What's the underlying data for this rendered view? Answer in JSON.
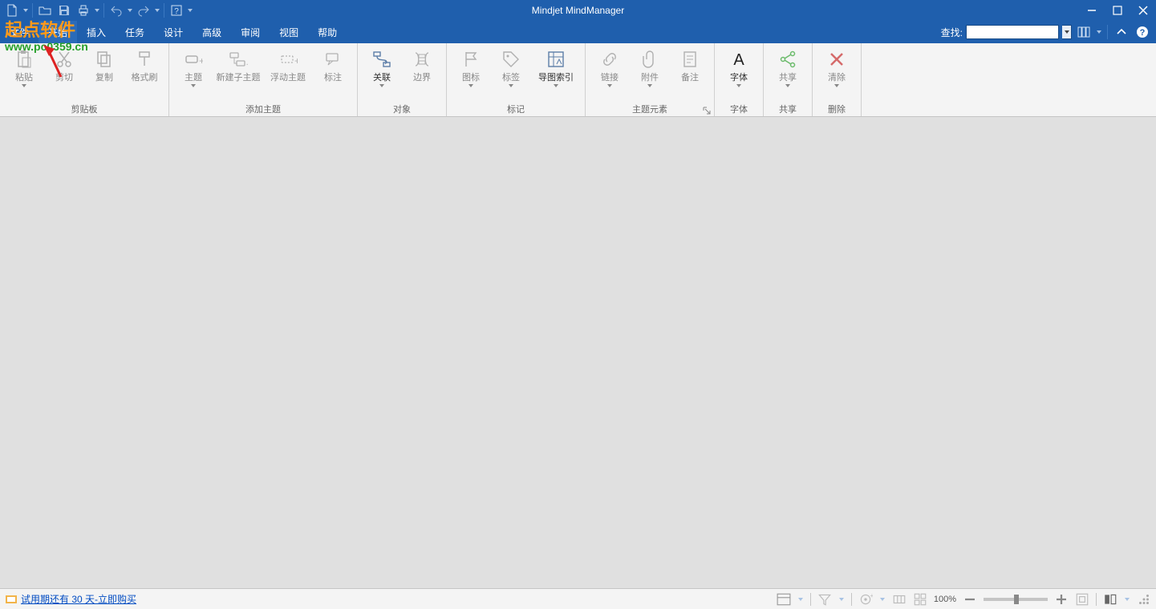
{
  "app_title": "Mindjet MindManager",
  "menubar": {
    "items": [
      "文件",
      "开始",
      "插入",
      "任务",
      "设计",
      "高级",
      "审阅",
      "视图",
      "帮助"
    ],
    "search_label": "查找:"
  },
  "ribbon": {
    "groups": [
      {
        "name": "clipboard",
        "label": "剪贴板",
        "buttons": [
          {
            "id": "paste",
            "label": "粘贴",
            "dd": true
          },
          {
            "id": "cut",
            "label": "剪切"
          },
          {
            "id": "copy",
            "label": "复制"
          },
          {
            "id": "formatpainter",
            "label": "格式刷"
          }
        ]
      },
      {
        "name": "addtopic",
        "label": "添加主题",
        "buttons": [
          {
            "id": "topic",
            "label": "主题",
            "dd": true
          },
          {
            "id": "subtopic",
            "label": "新建子主题",
            "wide": true
          },
          {
            "id": "floattopic",
            "label": "浮动主题",
            "wide": true
          },
          {
            "id": "callout",
            "label": "标注"
          }
        ]
      },
      {
        "name": "object",
        "label": "对象",
        "buttons": [
          {
            "id": "relation",
            "label": "关联",
            "dd": true,
            "strong": true
          },
          {
            "id": "boundary",
            "label": "边界"
          }
        ]
      },
      {
        "name": "mark",
        "label": "标记",
        "buttons": [
          {
            "id": "icon",
            "label": "图标",
            "dd": true
          },
          {
            "id": "tag",
            "label": "标签",
            "dd": true
          },
          {
            "id": "mapindex",
            "label": "导图索引",
            "dd": true,
            "strong": true,
            "wide": true
          }
        ]
      },
      {
        "name": "topicel",
        "label": "主题元素",
        "launcher": true,
        "buttons": [
          {
            "id": "link",
            "label": "链接",
            "dd": true
          },
          {
            "id": "attach",
            "label": "附件",
            "dd": true
          },
          {
            "id": "note",
            "label": "备注"
          }
        ]
      },
      {
        "name": "font",
        "label": "字体",
        "buttons": [
          {
            "id": "font",
            "label": "字体",
            "dd": true,
            "strong": true
          }
        ]
      },
      {
        "name": "share",
        "label": "共享",
        "buttons": [
          {
            "id": "share",
            "label": "共享",
            "dd": true
          }
        ]
      },
      {
        "name": "delete",
        "label": "删除",
        "buttons": [
          {
            "id": "clear",
            "label": "清除",
            "dd": true
          }
        ]
      }
    ]
  },
  "statusbar": {
    "trial_text": "试用期还有 30 天-立即购买",
    "zoom": "100%"
  },
  "watermark": {
    "text": "起点软件",
    "url": "www.pc0359.cn"
  }
}
